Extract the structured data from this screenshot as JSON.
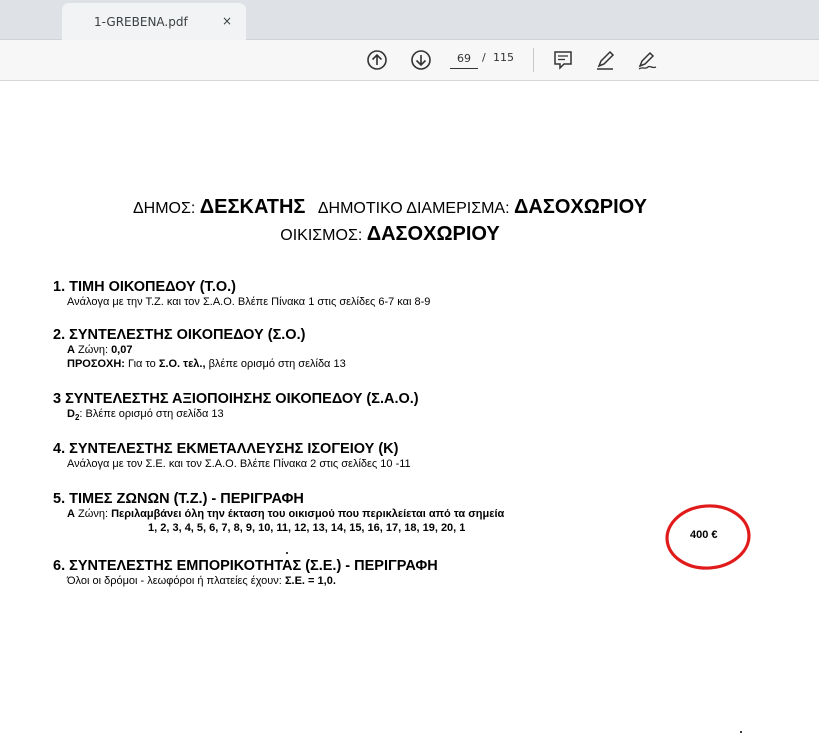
{
  "tab": {
    "title": "1-GREBENA.pdf",
    "close": "×"
  },
  "toolbar": {
    "page_current": "69",
    "page_separator": "/",
    "page_total": "115"
  },
  "document": {
    "header": {
      "line1_label_a": "ΔΗΜΟΣ:",
      "line1_value_a": "ΔΕΣΚΑΤΗΣ",
      "line1_label_b": "ΔΗΜΟΤΙΚΟ ΔΙΑΜΕΡΙΣΜΑ:",
      "line1_value_b": "ΔΑΣΟΧΩΡΙΟΥ",
      "line2_label": "ΟΙΚΙΣΜΟΣ:",
      "line2_value": "ΔΑΣΟΧΩΡΙΟΥ"
    },
    "s1": {
      "heading": "1. ΤΙΜΗ  ΟΙΚΟΠΕΔΟΥ (Τ.Ο.)",
      "line": "Ανάλογα με την Τ.Ζ. και τον Σ.Α.Ο. Βλέπε Πίνακα 1 στις σελίδες  6-7 και  8-9"
    },
    "s2": {
      "heading": "2. ΣΥΝΤΕΛΕΣΤΗΣ ΟΙΚΟΠΕΔΟΥ (Σ.Ο.)",
      "zone_label": "Α",
      "zone_text": "Ζώνη:",
      "zone_value": "0,07",
      "note_label": "ΠΡΟΣΟΧΗ:",
      "note_text_a": "Για το",
      "note_bold": "Σ.Ο. τελ.,",
      "note_text_b": "βλέπε ορισμό στη σελίδα 13"
    },
    "s3": {
      "heading": "3  ΣΥΝΤΕΛΕΣΤΗΣ ΑΞΙΟΠΟΙΗΣΗΣ ΟΙΚΟΠΕΔΟΥ (Σ.Α.Ο.)",
      "d_label": "D",
      "d_sub": "2",
      "d_text": ": Βλέπε ορισμό στη σελίδα 13"
    },
    "s4": {
      "heading": "4. ΣΥΝΤΕΛΕΣΤΗΣ ΕΚΜΕΤΑΛΛΕΥΣΗΣ ΙΣΟΓΕΙΟΥ (Κ)",
      "line": "Ανάλογα με τον Σ.Ε. και τον Σ.Α.Ο. Βλέπε Πίνακα 2 στις σελίδες 10 -11"
    },
    "s5": {
      "heading": "5. ΤΙΜΕΣ ΖΩΝΩΝ (Τ.Ζ.) - ΠΕΡΙΓΡΑΦΗ",
      "zone_label": "Α",
      "zone_text": "Ζώνη:",
      "zone_desc": "Περιλαμβάνει όλη την έκταση του οικισμού που περικλείεται από τα σημεία",
      "points": "1, 2, 3, 4, 5, 6, 7, 8,  9, 10, 11, 12, 13, 14, 15, 16, 17, 18, 19, 20, 1",
      "price": "400 €"
    },
    "s6": {
      "heading": "6. ΣΥΝΤΕΛΕΣΤΗΣ ΕΜΠΟΡΙΚΟΤΗΤΑΣ (Σ.Ε.) - ΠΕΡΙΓΡΑΦΗ",
      "line_a": "Όλοι οι δρόμοι - λεωφόροι ή πλατείες  έχουν:",
      "line_bold": "Σ.Ε. = 1,0."
    }
  },
  "colors": {
    "annotation_circle": "#e11b1b",
    "tab_strip": "#dee1e6",
    "toolbar": "#f7f7f7"
  },
  "icons": [
    "arrow-up-circle-icon",
    "arrow-down-circle-icon",
    "comment-icon",
    "pen-icon",
    "signature-pen-icon"
  ]
}
